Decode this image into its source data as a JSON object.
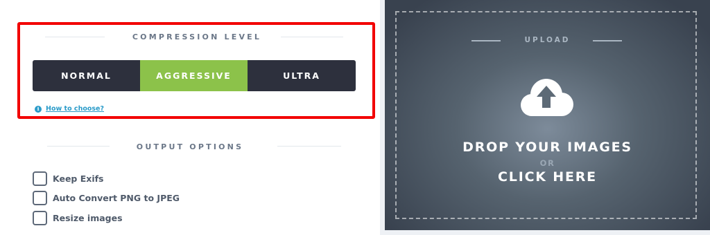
{
  "compression": {
    "title": "COMPRESSION LEVEL",
    "options": [
      "NORMAL",
      "AGGRESSIVE",
      "ULTRA"
    ],
    "selected": "AGGRESSIVE",
    "help_link": "How to choose?"
  },
  "output": {
    "title": "OUTPUT OPTIONS",
    "options": [
      {
        "label": "Keep Exifs",
        "checked": false
      },
      {
        "label": "Auto Convert PNG to JPEG",
        "checked": false
      },
      {
        "label": "Resize images",
        "checked": false
      }
    ]
  },
  "upload": {
    "label": "UPLOAD",
    "drop_text": "DROP YOUR IMAGES",
    "or_text": "OR",
    "click_text": "CLICK HERE",
    "icon": "cloud-upload-icon"
  },
  "colors": {
    "accent_selected": "#8cc24a",
    "segment_bg": "#2d303d",
    "highlight": "#f20000",
    "link": "#2a9bc9"
  }
}
